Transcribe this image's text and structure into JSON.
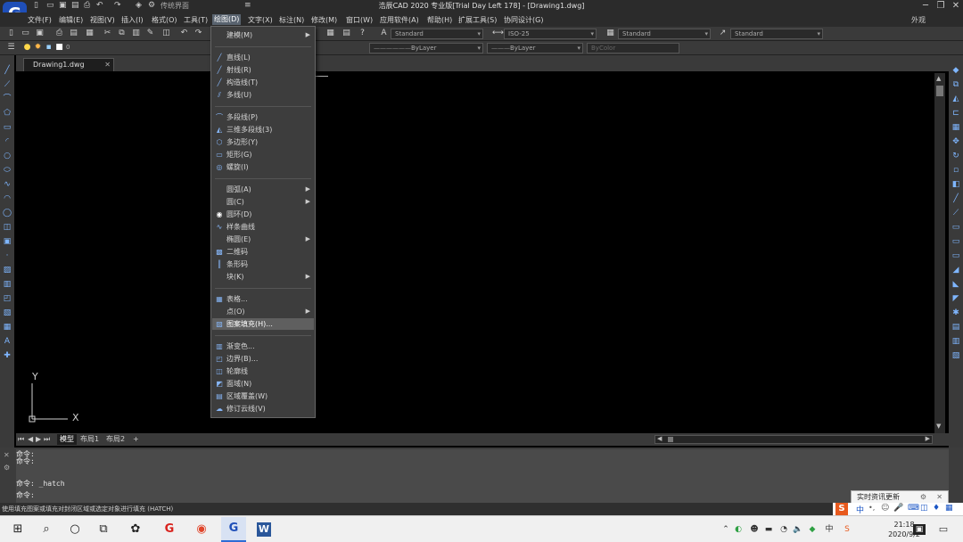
{
  "window": {
    "title": "浩辰CAD 2020 专业版[Trial Day Left 178] - [Drawing1.dwg]",
    "workspace": "传统界面",
    "external_label": "外观"
  },
  "menubar": {
    "items": [
      "文件(F)",
      "编辑(E)",
      "视图(V)",
      "插入(I)",
      "格式(O)",
      "工具(T)",
      "绘图(D)",
      "文字(X)",
      "标注(N)",
      "修改(M)",
      "窗口(W)",
      "应用软件(A)",
      "帮助(H)",
      "扩展工具(S)",
      "协同设计(G)"
    ],
    "active_index": 6
  },
  "toolbar": {
    "text_style": "Standard",
    "dim_style": "ISO-25",
    "table_style": "Standard",
    "mleader_style": "Standard",
    "layer": "0",
    "linetype1": "ByLayer",
    "linetype2": "ByLayer",
    "color": "ByColor"
  },
  "doc_tab": {
    "label": "Drawing1.dwg"
  },
  "layout_tabs": [
    "模型",
    "布局1",
    "布局2",
    "+"
  ],
  "draw_menu": [
    {
      "label": "建模(M)",
      "icon": "",
      "sub": true
    },
    {
      "sep": true
    },
    {
      "label": "直线(L)",
      "icon": "line-icon"
    },
    {
      "label": "射线(R)",
      "icon": "ray-icon"
    },
    {
      "label": "构造线(T)",
      "icon": "xline-icon"
    },
    {
      "label": "多线(U)",
      "icon": "mline-icon"
    },
    {
      "sep": true
    },
    {
      "label": "多段线(P)",
      "icon": "pline-icon"
    },
    {
      "label": "三维多段线(3)",
      "icon": "3dpoly-icon"
    },
    {
      "label": "多边形(Y)",
      "icon": "polygon-icon"
    },
    {
      "label": "矩形(G)",
      "icon": "rectangle-icon"
    },
    {
      "label": "螺旋(I)",
      "icon": "helix-icon"
    },
    {
      "sep": true
    },
    {
      "label": "圆弧(A)",
      "icon": "",
      "sub": true
    },
    {
      "label": "圆(C)",
      "icon": "",
      "sub": true
    },
    {
      "label": "圆环(D)",
      "icon": "donut-icon"
    },
    {
      "label": "样条曲线",
      "icon": "spline-icon"
    },
    {
      "label": "椭圆(E)",
      "icon": "",
      "sub": true
    },
    {
      "label": "二维码",
      "icon": "qrcode-icon"
    },
    {
      "label": "条形码",
      "icon": "barcode-icon"
    },
    {
      "label": "块(K)",
      "icon": "",
      "sub": true
    },
    {
      "sep": true
    },
    {
      "label": "表格...",
      "icon": "table-icon"
    },
    {
      "label": "点(O)",
      "icon": "",
      "sub": true
    },
    {
      "label": "图案填充(H)...",
      "icon": "hatch-icon",
      "highlight": true
    },
    {
      "sep": true
    },
    {
      "label": "渐变色...",
      "icon": "gradient-icon"
    },
    {
      "label": "边界(B)...",
      "icon": "boundary-icon"
    },
    {
      "label": "轮廓线",
      "icon": "outline-icon"
    },
    {
      "label": "面域(N)",
      "icon": "region-icon"
    },
    {
      "label": "区域覆盖(W)",
      "icon": "wipeout-icon"
    },
    {
      "label": "修订云线(V)",
      "icon": "revcloud-icon"
    }
  ],
  "command_lines": [
    "命令:",
    "命令:",
    "命令: _hatch",
    "命令:"
  ],
  "status_text": "使用填充图案或填充对封闭区域或选定对象进行填充 (HATCH)",
  "ime": {
    "popup": "实时资讯更新",
    "lang": "中"
  },
  "taskbar": {
    "time": "21:18",
    "date": "2020/9/2"
  },
  "ucs": {
    "x_label": "X",
    "y_label": "Y"
  }
}
